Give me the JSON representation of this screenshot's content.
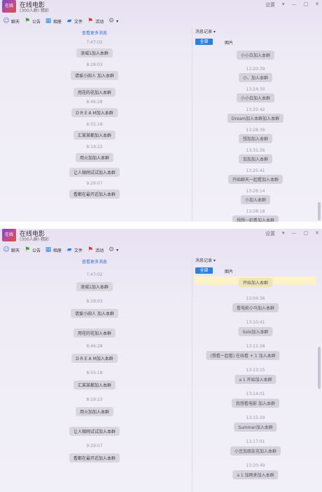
{
  "app": {
    "group_name": "在线电影",
    "group_meta": "(300人群) 精彩",
    "avatar_text": "在线"
  },
  "window_controls": [
    "设置",
    "▾",
    "—",
    "□",
    "✕"
  ],
  "toolbar": [
    {
      "icon": "chat-icon",
      "glyph": "☺",
      "label": "聊天"
    },
    {
      "icon": "flag-icon",
      "glyph": "⚑",
      "label": "公告"
    },
    {
      "icon": "photo-icon",
      "glyph": "▦",
      "label": "相册"
    },
    {
      "icon": "folder-icon",
      "glyph": "▰",
      "label": "文件"
    },
    {
      "icon": "activity-icon",
      "glyph": "⚑",
      "label": "活动"
    },
    {
      "icon": "settings-icon",
      "glyph": "⚙",
      "label": "▾"
    }
  ],
  "left_panel": {
    "load_more": "查看更多消息",
    "messages": [
      {
        "time": "7:47:02",
        "text": "浪城1加入本群"
      },
      {
        "time": "8:28:03",
        "text": "请爱小田人 加入本群"
      },
      {
        "time": "",
        "text": "用花的花加入本群"
      },
      {
        "time": "8:46:28",
        "text": "D R E A M加入本群"
      },
      {
        "time": "8:55:18",
        "text": "汇某某都加入本群"
      },
      {
        "time": "8:19:22",
        "text": "用火加加入本群"
      },
      {
        "time": "",
        "text": "让人微网试试加入本群"
      },
      {
        "time": "9:29:07",
        "text": "看都在最开近加入本群"
      }
    ]
  },
  "right_panel": {
    "title": "消息记录 ▾",
    "tab_all": "全部",
    "tab_images": "图片",
    "messages_top": [
      {
        "time": "",
        "text": "小小白加入本群"
      },
      {
        "time": "13:20:39",
        "text": "小、加入本群"
      },
      {
        "time": "13:24:30",
        "text": "小小白加入本群"
      },
      {
        "time": "13:25:42",
        "text": "Dream加入本群加入本群"
      },
      {
        "time": "13:28:39",
        "text": "想加加入本群"
      },
      {
        "time": "13:31:36",
        "text": "加加加入本群"
      },
      {
        "time": "13:25:41",
        "text": "开始聊天一起看加入本群"
      },
      {
        "time": "13:28:14",
        "text": "小加入本群"
      },
      {
        "time": "13:28:18",
        "text": "想想一起看加入本群"
      }
    ],
    "messages_bottom": [
      {
        "time": "",
        "text": "开始加入本群"
      },
      {
        "time": "13:04:36",
        "text": "看电影小马加入本群"
      },
      {
        "time": "13:10:41",
        "text": "Solo加入本群"
      },
      {
        "time": "13:11:28",
        "text": "(想看一起看) 在线看 + 1 加入本群"
      },
      {
        "time": "13:13:15",
        "text": "a 1 开始加入本群"
      },
      {
        "time": "13:14:01",
        "text": "我想看电影 加入本群"
      },
      {
        "time": "13:15:29",
        "text": "Summer加入本群"
      },
      {
        "time": "13:17:01",
        "text": "小豆加朋友花加入本群"
      },
      {
        "time": "13:20:49",
        "text": "a 1 加网来加入本群"
      }
    ]
  }
}
